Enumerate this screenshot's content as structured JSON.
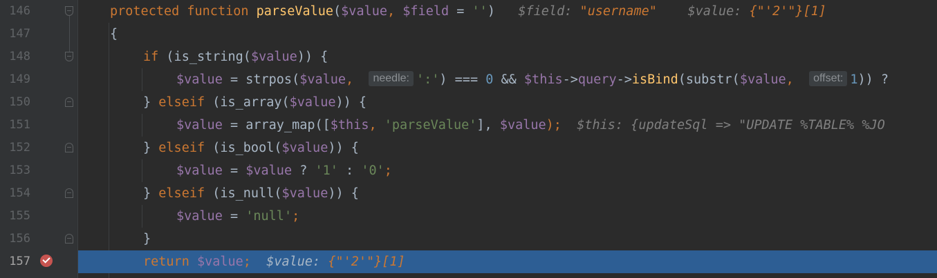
{
  "editor": {
    "lines": [
      {
        "num": "146"
      },
      {
        "num": "147"
      },
      {
        "num": "148"
      },
      {
        "num": "149"
      },
      {
        "num": "150"
      },
      {
        "num": "151"
      },
      {
        "num": "152"
      },
      {
        "num": "153"
      },
      {
        "num": "154"
      },
      {
        "num": "155"
      },
      {
        "num": "156"
      },
      {
        "num": "157"
      }
    ],
    "l146": {
      "kw1": "protected",
      "kw2": "function",
      "fname": "parseValue",
      "p1": "(",
      "v1": "$value",
      "p2": ", ",
      "v2": "$field",
      "p3": " = ",
      "s1": "''",
      "p4": ")",
      "hint1": "$field: ",
      "hintval1": "\"username\"",
      "hint2": "$value: ",
      "hintval2": "{\"'2'\"}[1]"
    },
    "l147": {
      "brace": "{"
    },
    "l148": {
      "kw": "if",
      "p1": " (is_string(",
      "v1": "$value",
      "p2": ")) {"
    },
    "l149": {
      "v1": "$value",
      "p1": " = strpos(",
      "v2": "$value",
      "p2": ", ",
      "hint_needle": "needle:",
      "s1": "':'",
      "p3": ") === ",
      "n1": "0",
      "p4": " && ",
      "v3": "$this",
      "p5": "->",
      "prop": "query",
      "p6": "->",
      "fn": "isBind",
      "p7": "(substr(",
      "v4": "$value",
      "p8": ", ",
      "hint_offset": "offset:",
      "n2": "1",
      "p9": ")) ?"
    },
    "l150": {
      "p0": "} ",
      "kw": "elseif",
      "p1": " (is_array(",
      "v1": "$value",
      "p2": ")) {"
    },
    "l151": {
      "v1": "$value",
      "p1": " = array_map([",
      "v2": "$this",
      "p2": ", ",
      "s1": "'parseValue'",
      "p3": "], ",
      "v3": "$value",
      "p4": ");",
      "hint": "$this: {updateSql => \"UPDATE %TABLE% %JO"
    },
    "l152": {
      "p0": "} ",
      "kw": "elseif",
      "p1": " (is_bool(",
      "v1": "$value",
      "p2": ")) {"
    },
    "l153": {
      "v1": "$value",
      "p1": " = ",
      "v2": "$value",
      "p2": " ? ",
      "s1": "'1'",
      "p3": " : ",
      "s2": "'0'",
      "p4": ";"
    },
    "l154": {
      "p0": "} ",
      "kw": "elseif",
      "p1": " (is_null(",
      "v1": "$value",
      "p2": ")) {"
    },
    "l155": {
      "v1": "$value",
      "p1": " = ",
      "s1": "'null'",
      "p2": ";"
    },
    "l156": {
      "brace": "}"
    },
    "l157": {
      "kw": "return",
      "v1": " $value",
      "p1": ";",
      "hint": "$value: ",
      "hintval": "{\"'2'\"}[1]"
    }
  },
  "colors": {
    "background": "#2b2b2b",
    "gutter": "#313335",
    "current_line": "#2d5e94",
    "keyword": "#cc7832",
    "function": "#ffc66d",
    "variable": "#9876aa",
    "string": "#6a8759",
    "number": "#6897bb",
    "breakpoint": "#c75450"
  }
}
